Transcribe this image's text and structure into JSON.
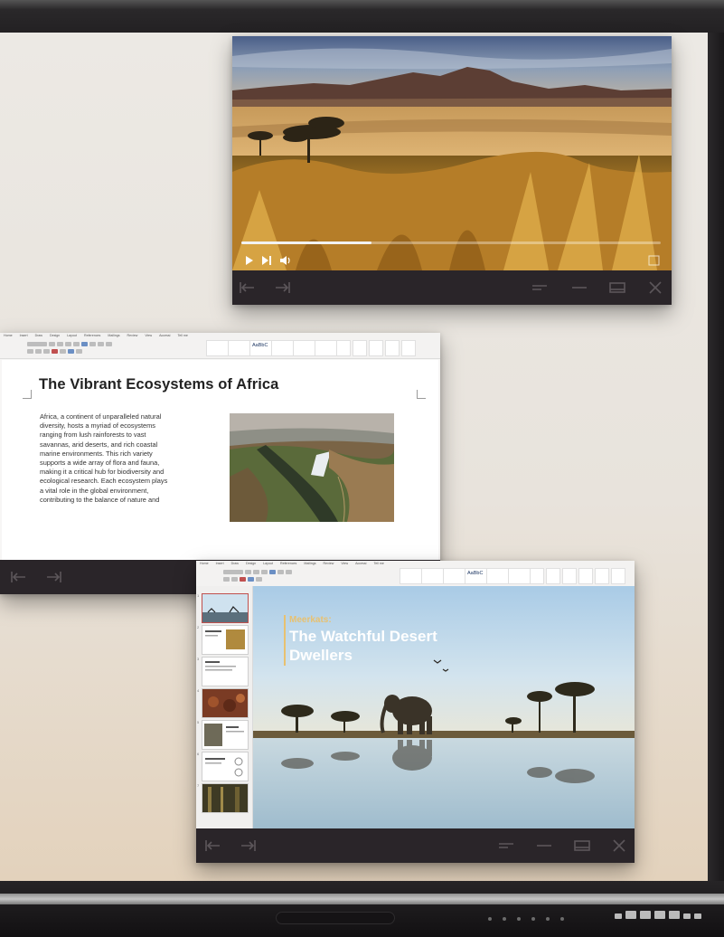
{
  "video_player": {
    "progress_percent": 31
  },
  "word_document": {
    "ribbon_tabs": [
      "Home",
      "Insert",
      "Draw",
      "Design",
      "Layout",
      "References",
      "Mailings",
      "Review",
      "View",
      "Accessi",
      "Tell me"
    ],
    "style_label_heading": "AaBbC",
    "title": "The Vibrant Ecosystems of Africa",
    "body_lines": [
      "Africa, a continent of unparalleled natural",
      "diversity, hosts a myriad of ecosystems",
      "ranging from lush rainforests to vast",
      "savannas, arid deserts, and rich coastal",
      "marine environments. This rich variety",
      "supports a wide array of flora and fauna,",
      "making it a critical hub for biodiversity and",
      "ecological research. Each ecosystem plays",
      "a vital role in the global environment,",
      "contributing to the balance of nature and"
    ]
  },
  "presentation": {
    "ribbon_tabs": [
      "Home",
      "Insert",
      "Draw",
      "Design",
      "Layout",
      "References",
      "Mailings",
      "Review",
      "View",
      "Accessi",
      "Tell me"
    ],
    "style_label_heading": "AaBbC",
    "slide_kicker": "Meerkats:",
    "slide_title": "The Watchful Desert Dwellers",
    "thumbnail_count": 7,
    "active_thumbnail": 1
  },
  "colors": {
    "window_bar": "#2a2529",
    "window_bar_icon": "#5c565a",
    "accent_gold": "#e8c170",
    "thumbnail_active": "#c0504d"
  },
  "icons": {
    "back": "arrow-left-bar-icon",
    "forward": "arrow-right-bar-icon",
    "snap": "snap-lines-icon",
    "minimize": "minimize-icon",
    "maximize": "maximize-icon",
    "close": "close-icon",
    "play": "play-icon",
    "skip": "skip-next-icon",
    "volume": "volume-icon",
    "fullscreen": "fullscreen-icon"
  }
}
